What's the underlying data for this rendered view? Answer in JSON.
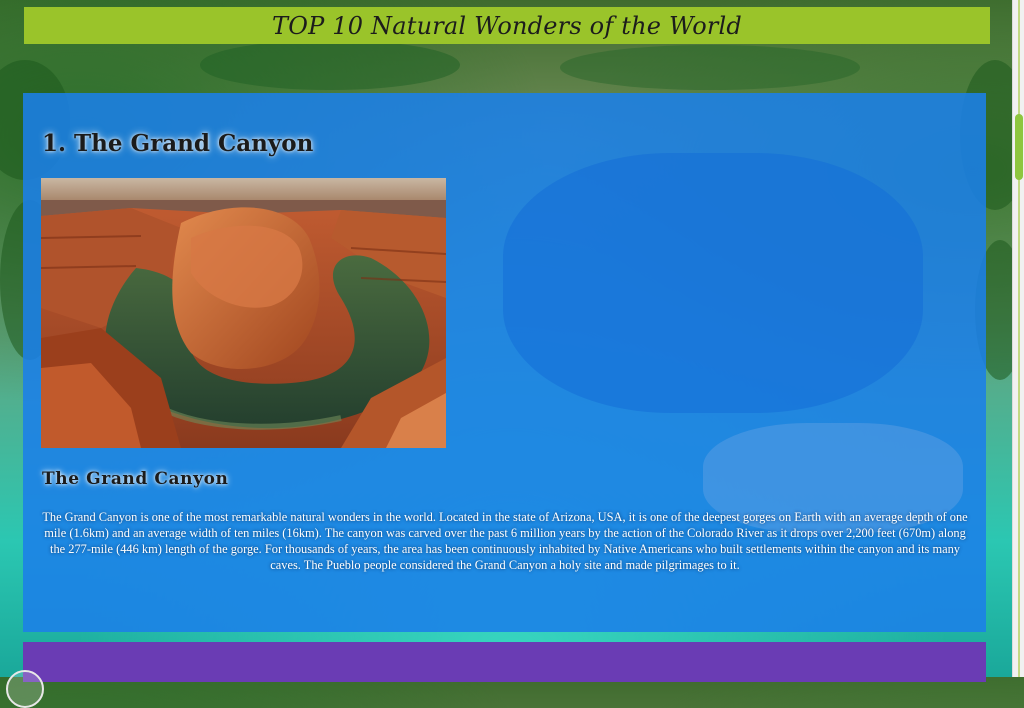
{
  "banner": {
    "title": "TOP 10 Natural Wonders of the World"
  },
  "section": {
    "heading": "1. The Grand Canyon",
    "image_alt": "The Grand Canyon horseshoe bend",
    "subheading": "The Grand Canyon",
    "description": "The Grand Canyon is one of the most remarkable natural wonders in the world. Located in the state of Arizona, USA, it is one of the deepest gorges on Earth with an average depth of one mile (1.6km) and an average width of ten miles (16km). The canyon was carved over the past 6 million years by the action of the Colorado River as it drops over 2,200 feet (670m) along the 277-mile (446 km) length of the gorge. For thousands of years, the area has been continuously inhabited by Native Americans who built settlements within the canyon and its many caves. The Pueblo people considered the Grand Canyon a holy site and made pilgrimages to it."
  },
  "colors": {
    "banner": "#9ac42a",
    "panel": "#1b80e8",
    "purple_band": "#6a3cb4",
    "scroll_thumb": "#8ec63f"
  },
  "icons": {
    "scroll": "scrollbar-thumb"
  }
}
